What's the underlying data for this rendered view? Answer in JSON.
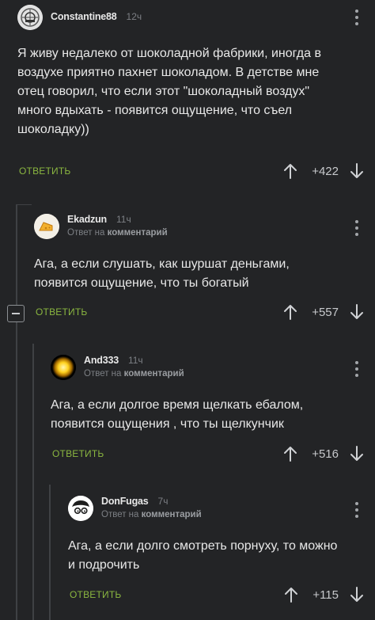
{
  "comments": [
    {
      "author": "Constantine88",
      "time": "12ч",
      "text": "Я живу недалеко от шоколадной фабрики, иногда в воздухе приятно пахнет шоколадом. В детстве мне отец говорил, что если этот \"шоколадный воздух\" много вдыхать - появится ощущение, что съел шоколадку))",
      "reply_label": "ОТВЕТИТЬ",
      "score": "+422"
    },
    {
      "author": "Ekadzun",
      "time": "11ч",
      "reply_prefix": "Ответ на",
      "reply_target": "комментарий",
      "text": "Ага, а если слушать, как шуршат деньгами, появится ощущение, что ты богатый",
      "reply_label": "ОТВЕТИТЬ",
      "score": "+557"
    },
    {
      "author": "And333",
      "time": "11ч",
      "reply_prefix": "Ответ на",
      "reply_target": "комментарий",
      "text": "Ага, а если долгое время щелкать ебалом, появится ощущения , что ты щелкунчик",
      "reply_label": "ОТВЕТИТЬ",
      "score": "+516"
    },
    {
      "author": "DonFugas",
      "time": "7ч",
      "reply_prefix": "Ответ на",
      "reply_target": "комментарий",
      "text": "Ага, а если долго смотреть порнуху, то можно и подрочить",
      "reply_label": "ОТВЕТИТЬ",
      "score": "+115"
    }
  ],
  "colors": {
    "background": "#232426",
    "reply_green": "#8ab640",
    "muted": "#7c7f84"
  }
}
